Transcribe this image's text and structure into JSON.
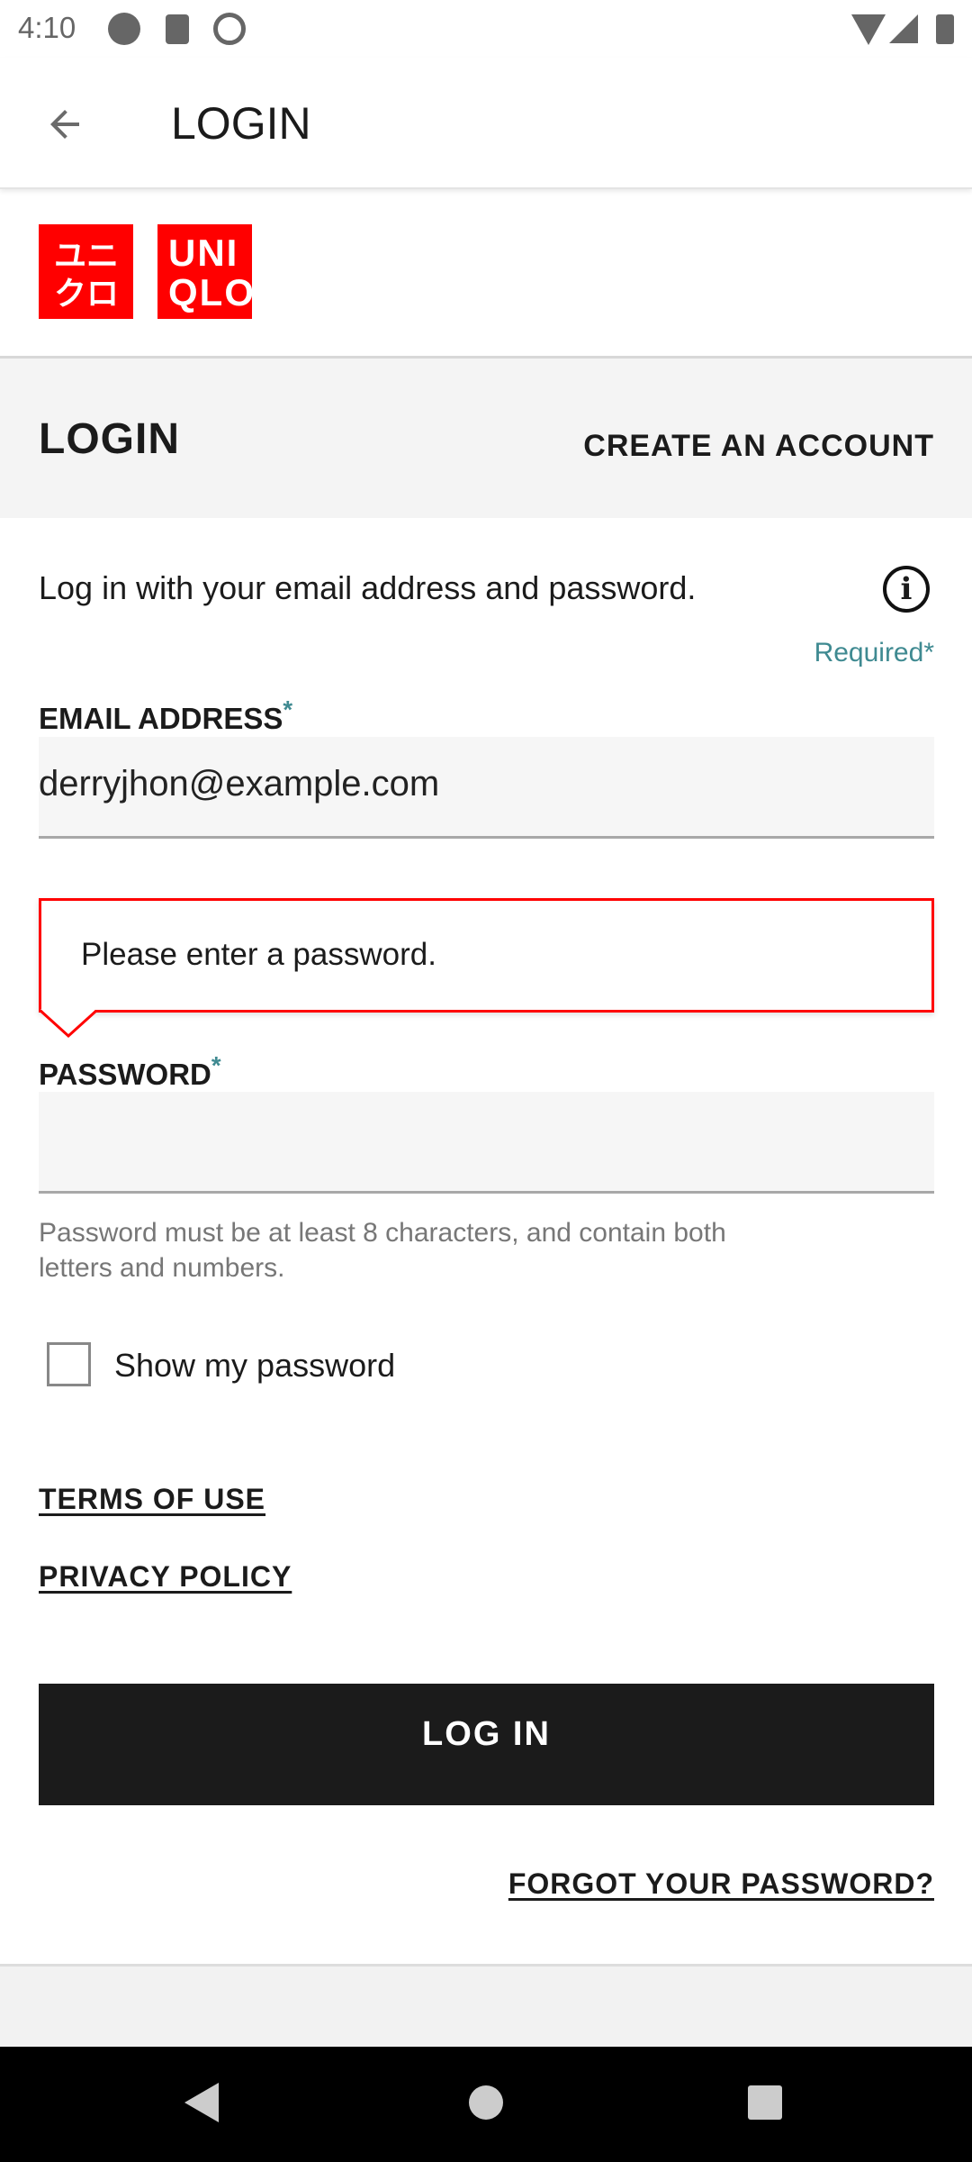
{
  "status_bar": {
    "time": "4:10"
  },
  "app_bar": {
    "title": "LOGIN"
  },
  "logo": {
    "katakana": "ユニクロ",
    "latin_line1": "UNI",
    "latin_line2": "QLO"
  },
  "tabs": {
    "login": "LOGIN",
    "create_account": "CREATE AN ACCOUNT"
  },
  "form": {
    "intro": "Log in with your email address and password.",
    "required_note": "Required",
    "asterisk": "*",
    "email_label": "EMAIL ADDRESS",
    "email_value": "derryjhon@example.com",
    "error_tooltip": "Please enter a password.",
    "password_label": "PASSWORD",
    "password_value": "",
    "password_hint_line1": "Password must be at least 8 characters, and contain both",
    "password_hint_line2": "letters and numbers.",
    "show_password_label": "Show my password",
    "show_password_checked": false
  },
  "links": {
    "terms": "TERMS OF USE",
    "privacy": "PRIVACY POLICY",
    "forgot": "FORGOT YOUR PASSWORD?"
  },
  "login_button": "LOG IN",
  "colors": {
    "brand": "#ff0000",
    "accent": "#3f8a91",
    "button": "#1b1b1b"
  }
}
